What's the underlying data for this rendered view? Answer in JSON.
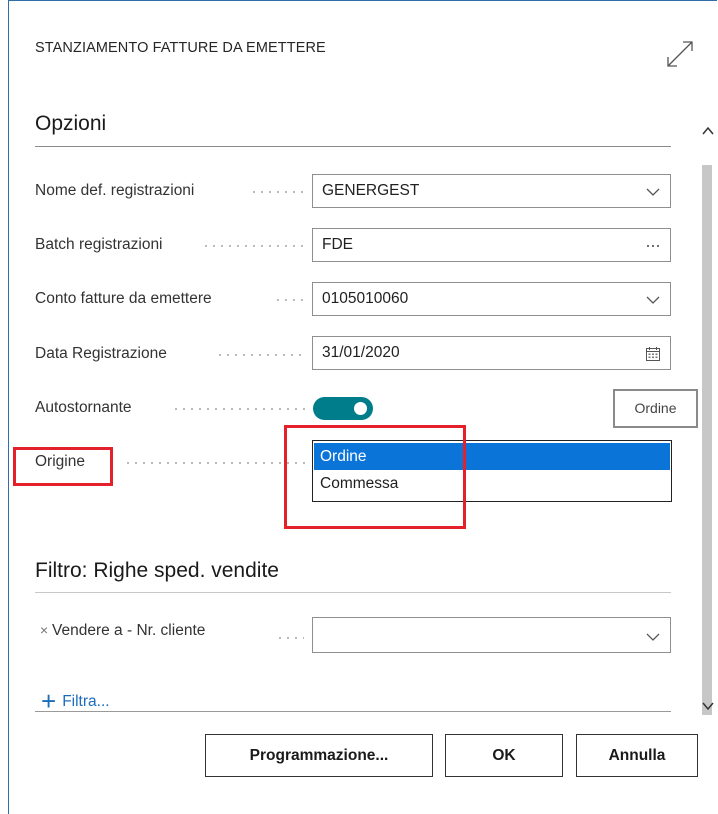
{
  "window": {
    "title": "STANZIAMENTO FATTURE DA EMETTERE"
  },
  "options": {
    "heading": "Opzioni",
    "fields": [
      {
        "label": "Nome def. registrazioni",
        "value": "GENERGEST",
        "icon": "chevron-down-icon"
      },
      {
        "label": "Batch registrazioni",
        "value": "FDE",
        "icon": "ellipsis-icon"
      },
      {
        "label": "Conto fatture da emettere",
        "value": "0105010060",
        "icon": "chevron-down-icon"
      },
      {
        "label": "Data Registrazione",
        "value": "31/01/2020",
        "icon": "calendar-icon"
      }
    ],
    "autostornante": {
      "label": "Autostornante",
      "on": true
    },
    "origine": {
      "label": "Origine",
      "options": [
        "Ordine",
        "Commessa"
      ],
      "selected": "Ordine",
      "tooltip": "Ordine"
    }
  },
  "filter": {
    "heading": "Filtro: Righe sped. vendite",
    "field_label": "Vendere a - Nr. cliente",
    "field_value": "",
    "remove_symbol": "×",
    "add_label": "Filtra..."
  },
  "buttons": {
    "schedule": "Programmazione...",
    "ok": "OK",
    "cancel": "Annulla"
  },
  "colors": {
    "accent": "#007d8a",
    "selection": "#0a74d8",
    "highlight_box": "#e4202a",
    "link": "#1b6dba"
  }
}
